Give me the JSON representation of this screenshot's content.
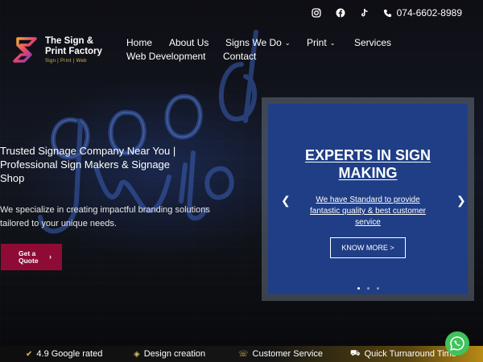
{
  "topbar": {
    "social": [
      "instagram-icon",
      "facebook-icon",
      "tiktok-icon"
    ],
    "phone": "074-6602-8989"
  },
  "logo": {
    "line1": "The Sign &",
    "line2": "Print Factory",
    "tagline": "Sign | Print | Web"
  },
  "nav": {
    "home": "Home",
    "about": "About Us",
    "signs": "Signs We Do",
    "print": "Print",
    "services": "Services",
    "web": "Web Development",
    "contact": "Contact"
  },
  "hero": {
    "title": "Trusted Signage Company Near You | Professional Sign Makers & Signage Shop",
    "subtitle": "We specialize in creating impactful branding solutions tailored to your unique needs.",
    "cta": "Get a Quote"
  },
  "slider": {
    "title": "EXPERTS IN SIGN MAKING",
    "description": "We have Standard to provide fantastic quality & best customer service",
    "button": "KNOW MORE >",
    "slide_count": 3,
    "active_slide": 1
  },
  "features": {
    "google": "4.9 Google rated",
    "design": "Design creation",
    "support": "Customer Service",
    "turnaround": "Quick Turnaround Time"
  },
  "colors": {
    "cta": "#8e0b35",
    "slide_bg": "#1f3e86",
    "whatsapp": "#3fc35a",
    "gold": "#d9b64a"
  }
}
